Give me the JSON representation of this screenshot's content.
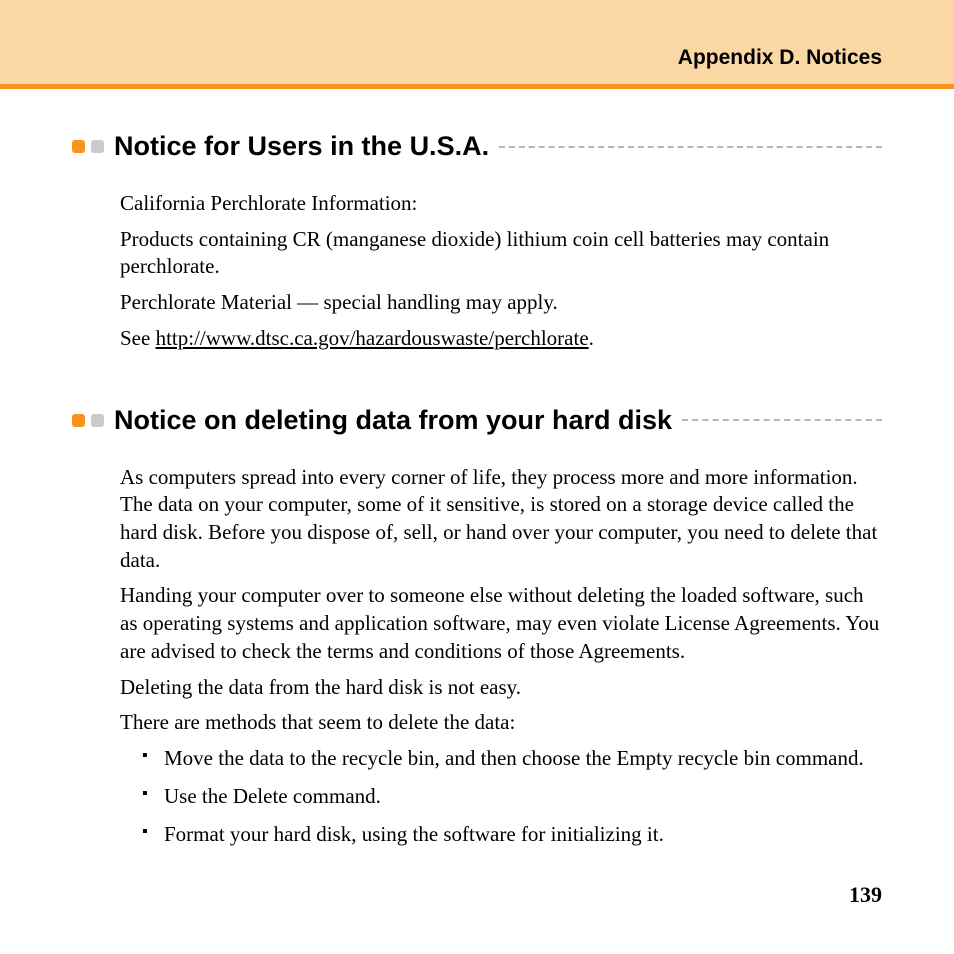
{
  "header": {
    "title": "Appendix D. Notices"
  },
  "section1": {
    "heading": "Notice for Users in the U.S.A.",
    "p1": "California Perchlorate Information:",
    "p2": "Products containing CR (manganese dioxide) lithium coin cell batteries may contain perchlorate.",
    "p3": "Perchlorate Material — special handling may apply.",
    "p4_prefix": "See ",
    "p4_link": "http://www.dtsc.ca.gov/hazardouswaste/perchlorate",
    "p4_suffix": "."
  },
  "section2": {
    "heading": "Notice on deleting data from your hard disk",
    "p1": "As computers spread into every corner of life, they process more and more information. The data on your computer, some of it sensitive, is stored on a storage device called the hard disk. Before you dispose of, sell, or hand over your computer, you need to delete that data.",
    "p2": "Handing your computer over to someone else without deleting the loaded software, such as operating systems and application software, may even violate License Agreements. You are advised to check the terms and conditions of those Agreements.",
    "p3": "Deleting the data from the hard disk is not easy.",
    "p4": "There are methods that seem to delete the data:",
    "bullets": [
      "Move the data to the recycle bin, and then choose the Empty recycle bin command.",
      "Use the Delete command.",
      "Format your hard disk, using the software for initializing it."
    ]
  },
  "page_number": "139"
}
